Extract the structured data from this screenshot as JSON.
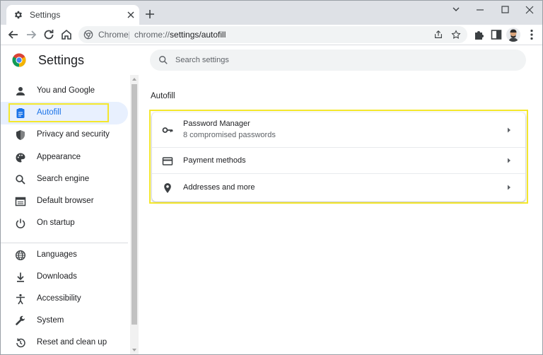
{
  "browser": {
    "tab_title": "Settings",
    "omnibox_site": "Chrome",
    "omnibox_separator": "|",
    "omnibox_url_prefix": "chrome://",
    "omnibox_url_path": "settings/autofill"
  },
  "page": {
    "title": "Settings",
    "search_placeholder": "Search settings"
  },
  "sidebar": {
    "items": [
      {
        "label": "You and Google",
        "icon": "person-icon"
      },
      {
        "label": "Autofill",
        "icon": "clipboard-icon",
        "active": true
      },
      {
        "label": "Privacy and security",
        "icon": "shield-icon"
      },
      {
        "label": "Appearance",
        "icon": "palette-icon"
      },
      {
        "label": "Search engine",
        "icon": "search-icon"
      },
      {
        "label": "Default browser",
        "icon": "browser-window-icon"
      },
      {
        "label": "On startup",
        "icon": "power-icon"
      },
      {
        "label": "Languages",
        "icon": "globe-icon"
      },
      {
        "label": "Downloads",
        "icon": "download-icon"
      },
      {
        "label": "Accessibility",
        "icon": "accessibility-icon"
      },
      {
        "label": "System",
        "icon": "wrench-icon"
      },
      {
        "label": "Reset and clean up",
        "icon": "restore-icon"
      }
    ]
  },
  "main": {
    "section_title": "Autofill",
    "rows": [
      {
        "title": "Password Manager",
        "subtitle": "8 compromised passwords",
        "icon": "key-icon"
      },
      {
        "title": "Payment methods",
        "icon": "credit-card-icon"
      },
      {
        "title": "Addresses and more",
        "icon": "location-pin-icon"
      }
    ]
  },
  "colors": {
    "accent": "#1a73e8",
    "active_nav_bg": "#e8f0fe",
    "highlight": "#f4e72c",
    "tabstrip_bg": "#dee1e6"
  }
}
